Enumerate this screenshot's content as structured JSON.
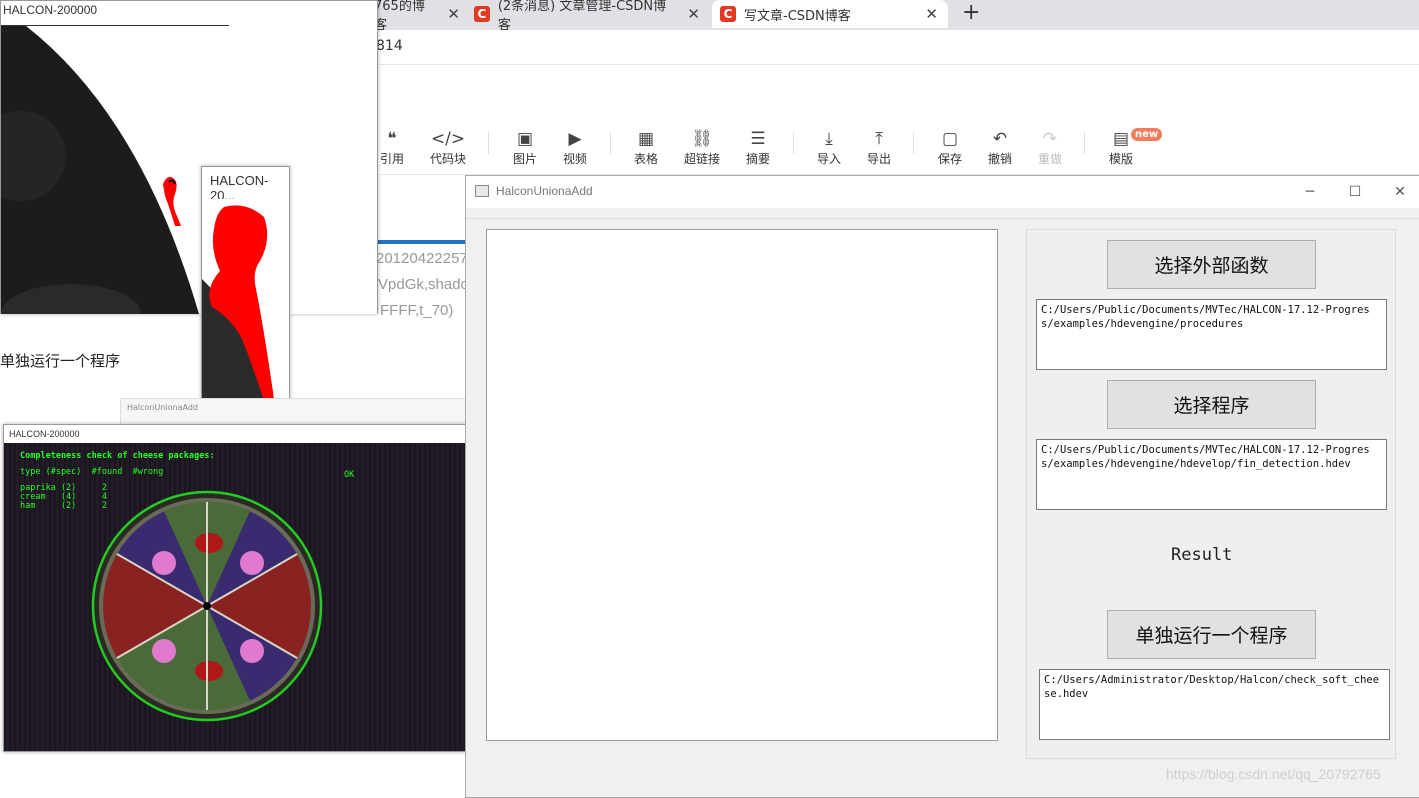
{
  "browser": {
    "tabs": [
      {
        "label": "765的博客_"
      },
      {
        "label": "(2条消息) 文章管理-CSDN博客"
      },
      {
        "label": "写文章-CSDN博客"
      }
    ],
    "new_tab": "+",
    "address_fragment": "814"
  },
  "toolbar": {
    "items": [
      {
        "icon": "quote-icon",
        "glyph": "❝",
        "label": "引用"
      },
      {
        "icon": "code-icon",
        "glyph": "</>",
        "label": "代码块"
      },
      {
        "icon": "image-icon",
        "glyph": "▣",
        "label": "图片"
      },
      {
        "icon": "video-icon",
        "glyph": "▶",
        "label": "视频"
      },
      {
        "icon": "table-icon",
        "glyph": "▦",
        "label": "表格"
      },
      {
        "icon": "link-icon",
        "glyph": "⛓",
        "label": "超链接"
      },
      {
        "icon": "summary-icon",
        "glyph": "☰",
        "label": "摘要"
      },
      {
        "icon": "import-icon",
        "glyph": "⤓",
        "label": "导入"
      },
      {
        "icon": "export-icon",
        "glyph": "⤒",
        "label": "导出"
      },
      {
        "icon": "save-icon",
        "glyph": "▢",
        "label": "保存"
      },
      {
        "icon": "undo-icon",
        "glyph": "↶",
        "label": "撤销"
      },
      {
        "icon": "redo-icon",
        "glyph": "↷",
        "label": "重做"
      },
      {
        "icon": "template-icon",
        "glyph": "▤",
        "label": "模版"
      }
    ],
    "new_badge": "new"
  },
  "editor": {
    "frag1": "20120422257",
    "frag2": "VpdGk,shado",
    "frag3": "FFFF,t_70)",
    "body_text": "单独运行一个程序"
  },
  "halcon_windows": {
    "main_title": "HALCON-200000",
    "small_title": "HALCON-20...",
    "cheese_title": "HALCON-200000",
    "mini_app_title": "HalconUnionaAdd",
    "cheese_overlay": {
      "heading": "Completeness check of cheese packages:",
      "header_row": "type (#spec)  #found  #wrong",
      "rows": [
        "paprika (2)     2",
        "cream   (4)     4",
        "ham     (2)     2"
      ],
      "status": "OK"
    }
  },
  "dialog": {
    "title": "HalconUnionaAdd",
    "select_external_button": "选择外部函数",
    "external_path": "C:/Users/Public/Documents/MVTec/HALCON-17.12-Progress/examples/hdevengine/procedures",
    "select_program_button": "选择程序",
    "program_path": "C:/Users/Public/Documents/MVTec/HALCON-17.12-Progress/examples/hdevengine/hdevelop/fin_detection.hdev",
    "result_label": "Result",
    "run_single_button": "单独运行一个程序",
    "single_program_path": "C:/Users/Administrator/Desktop/Halcon/check_soft_cheese.hdev"
  },
  "watermark": "https://blog.csdn.net/qq_20792765",
  "colors": {
    "csdn_red": "#e03a23",
    "halcon_red": "#ff0000",
    "overlay_green": "#22ff22"
  }
}
